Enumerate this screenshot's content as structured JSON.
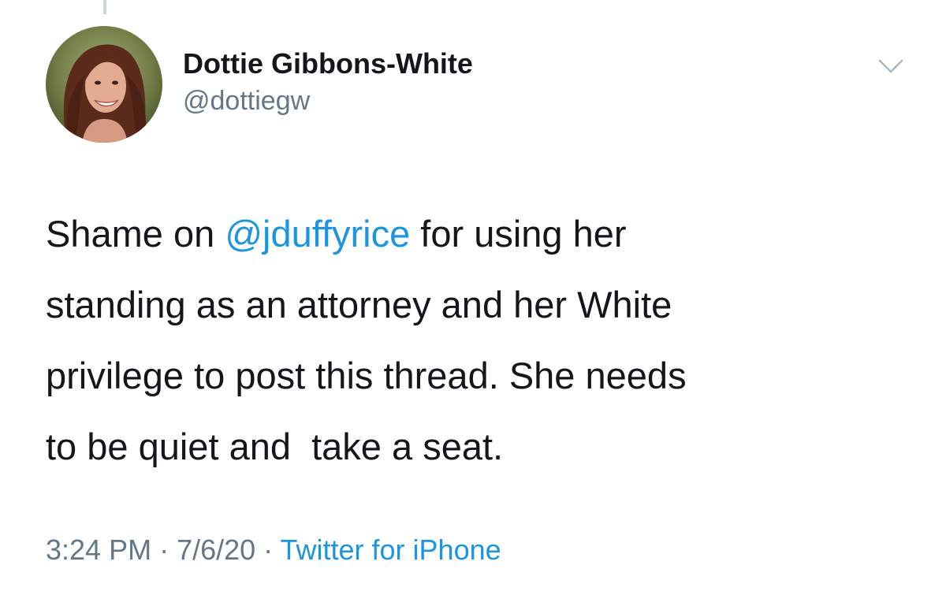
{
  "tweet": {
    "author": {
      "display_name": "Dottie Gibbons-White",
      "handle": "@dottiegw",
      "avatar_icon": "profile-photo"
    },
    "text": {
      "before_mention": "Shame on ",
      "mention": "@jduffyrice",
      "line1_rest": " for using her",
      "line2": "standing as an attorney and her White",
      "line3": "privilege to post this thread. She needs",
      "line4": "to be quiet and  take a seat."
    },
    "meta": {
      "time": "3:24 PM",
      "separator": " · ",
      "date": "7/6/20",
      "source": "Twitter for iPhone"
    },
    "menu_icon": "chevron-down-icon"
  },
  "colors": {
    "link": "#1b95e0",
    "text": "#14171a",
    "secondary": "#657786",
    "thread_line": "#ccd6dd"
  }
}
